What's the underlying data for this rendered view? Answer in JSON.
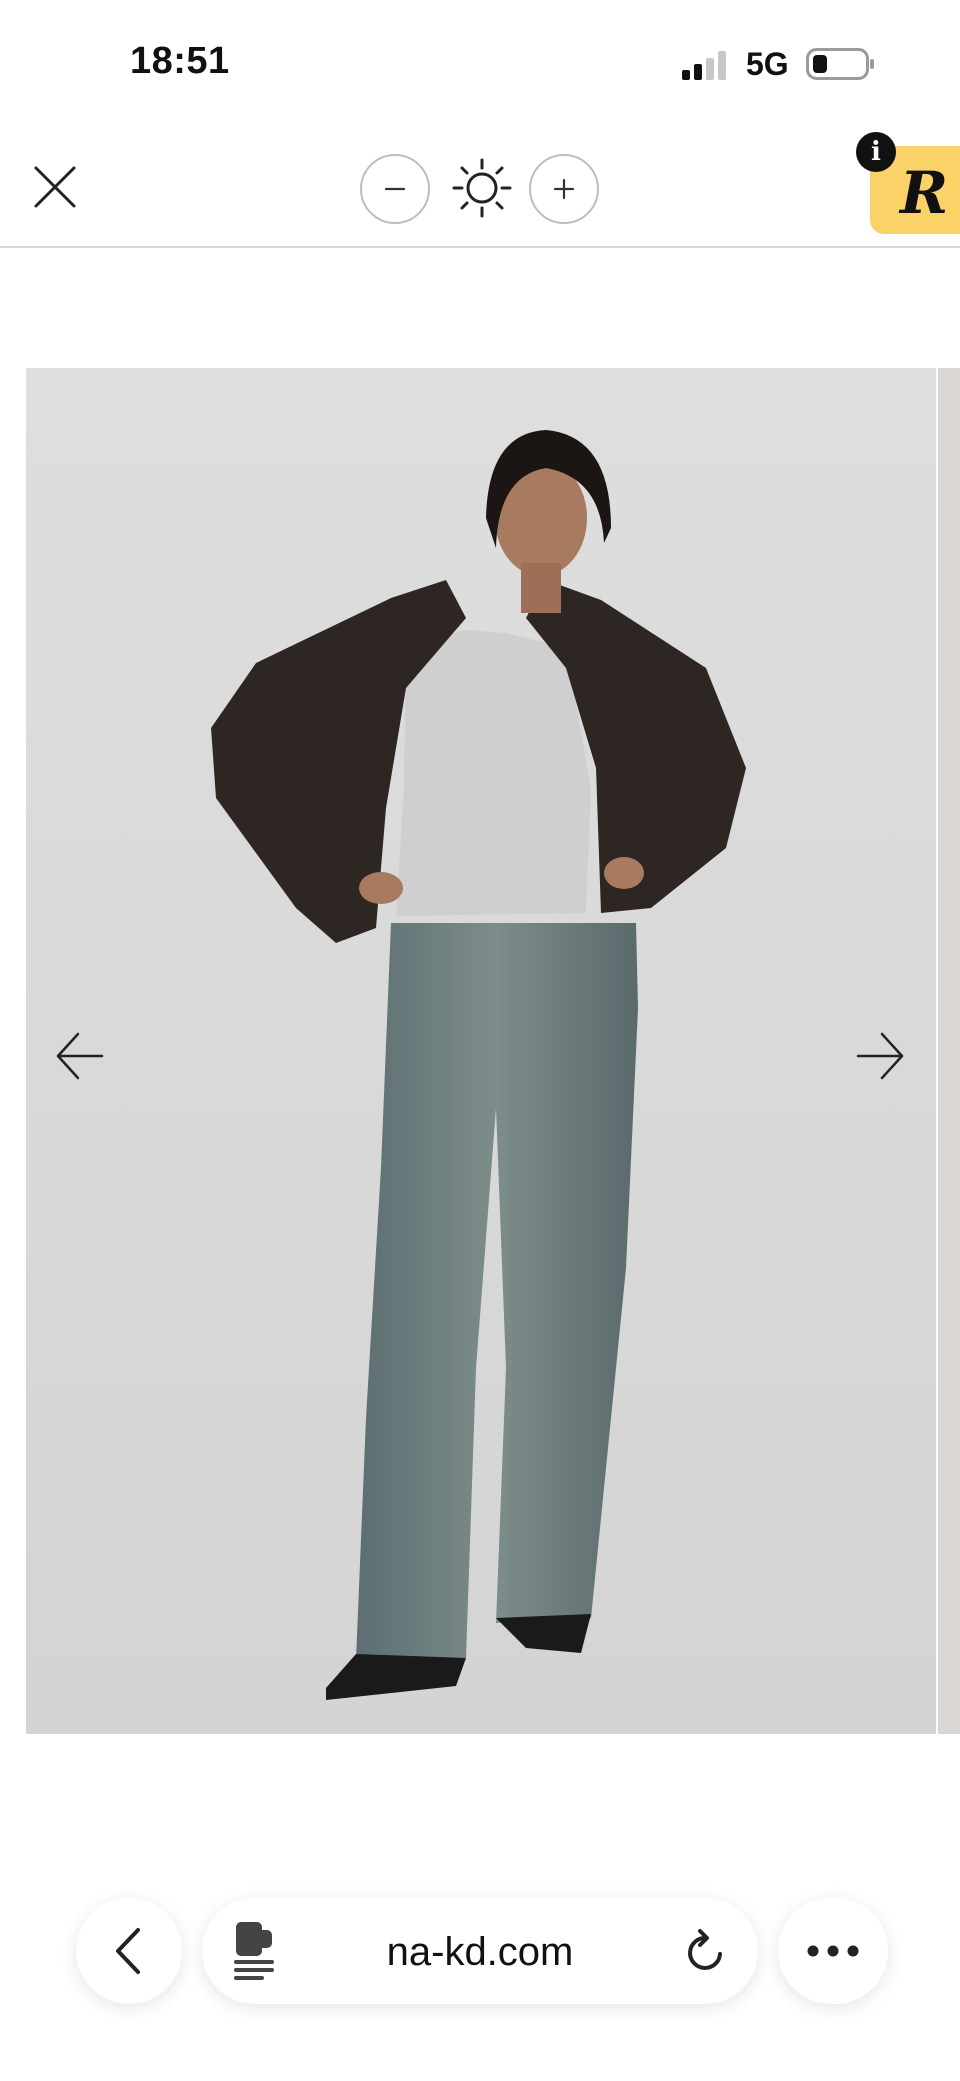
{
  "status_bar": {
    "time": "18:51",
    "network": "5G"
  },
  "toolbar": {
    "icons": [
      "close-icon",
      "zoom-out-icon",
      "brightness-icon",
      "zoom-in-icon",
      "info-icon"
    ],
    "logo_letter": "R",
    "info_letter": "i",
    "accent_color": "#fbd268"
  },
  "gallery": {
    "icons": [
      "arrow-left-icon",
      "arrow-right-icon"
    ]
  },
  "browser_bar": {
    "url": "na-kd.com",
    "icons": [
      "back-chevron-icon",
      "reader-icon",
      "reload-icon",
      "more-icon"
    ]
  }
}
